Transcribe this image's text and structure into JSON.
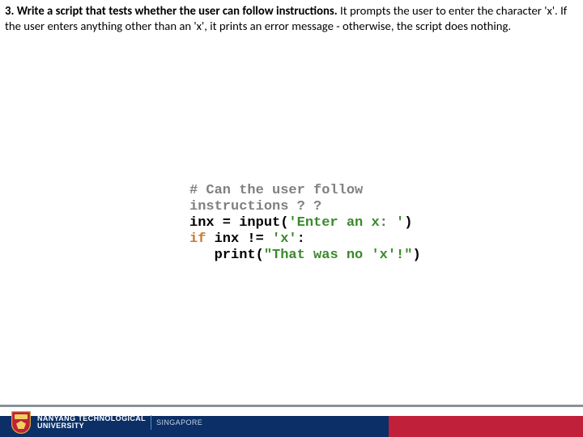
{
  "question": {
    "bold": "3. Write a script that tests whether the user can follow instructions.",
    "rest": " It prompts the user to enter the character 'x'. If the user enters anything other than an 'x', it prints an error message - otherwise, the script does nothing."
  },
  "code": {
    "l1": "# Can the user follow",
    "l2": "instructions ? ?",
    "l3a": "inx = input(",
    "l3b": "'Enter an x: '",
    "l3c": ")",
    "l4a": "if",
    "l4b": " inx != ",
    "l4c": "'x'",
    "l4d": ":",
    "l5a": "   print(",
    "l5b": "\"That was no 'x'!\"",
    "l5c": ")"
  },
  "footer": {
    "university_line1": "NANYANG TECHNOLOGICAL",
    "university_line2": "UNIVERSITY",
    "country": "SINGAPORE"
  }
}
